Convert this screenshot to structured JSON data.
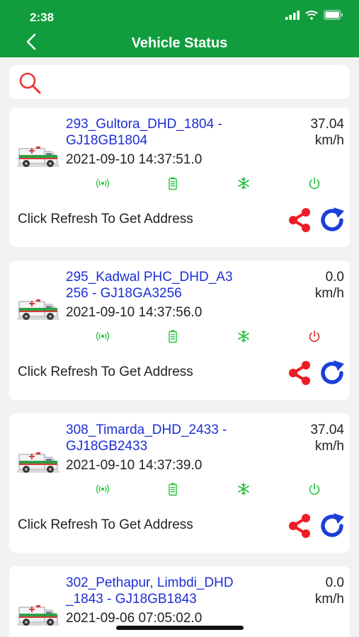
{
  "status_bar": {
    "time": "2:38"
  },
  "header": {
    "title": "Vehicle Status"
  },
  "search": {
    "placeholder": ""
  },
  "colors": {
    "header_bg": "#119d3d",
    "link": "#1d2fd6",
    "on": "#22c43a",
    "off": "#e02a2a",
    "action_red": "#ee1c24",
    "action_blue": "#1b3fd8"
  },
  "vehicles": [
    {
      "name": "293_Gultora_DHD_1804 - GJ18GB1804",
      "name_line1": "293_Gultora_DHD_1804 -",
      "name_line2": "GJ18GB1804",
      "speed": "37.04",
      "speed_unit": "km/h",
      "timestamp": "2021-09-10 14:37:51.0",
      "indicators": [
        "signal-icon",
        "battery-icon",
        "ac-icon",
        "power-on-icon"
      ],
      "address_text": "Click Refresh To Get Address"
    },
    {
      "name": "295_Kadwal PHC_DHD_A3256 - GJ18GA3256",
      "name_line1": "295_Kadwal PHC_DHD_A3",
      "name_line2": "256 - GJ18GA3256",
      "speed": "0.0",
      "speed_unit": "km/h",
      "timestamp": "2021-09-10 14:37:56.0",
      "indicators": [
        "signal-icon",
        "battery-icon",
        "ac-icon",
        "power-off-icon"
      ],
      "address_text": "Click Refresh To Get Address"
    },
    {
      "name": "308_Timarda_DHD_2433 - GJ18GB2433",
      "name_line1": "308_Timarda_DHD_2433 -",
      "name_line2": "GJ18GB2433",
      "speed": "37.04",
      "speed_unit": "km/h",
      "timestamp": "2021-09-10 14:37:39.0",
      "indicators": [
        "signal-icon",
        "battery-icon",
        "ac-icon",
        "power-on-icon"
      ],
      "address_text": "Click Refresh To Get Address"
    },
    {
      "name": "302_Pethapur, Limbdi_DHD_1843 - GJ18GB1843",
      "name_line1": "302_Pethapur, Limbdi_DHD",
      "name_line2": "_1843 - GJ18GB1843",
      "speed": "0.0",
      "speed_unit": "km/h",
      "timestamp": "2021-09-06 07:05:02.0"
    }
  ]
}
